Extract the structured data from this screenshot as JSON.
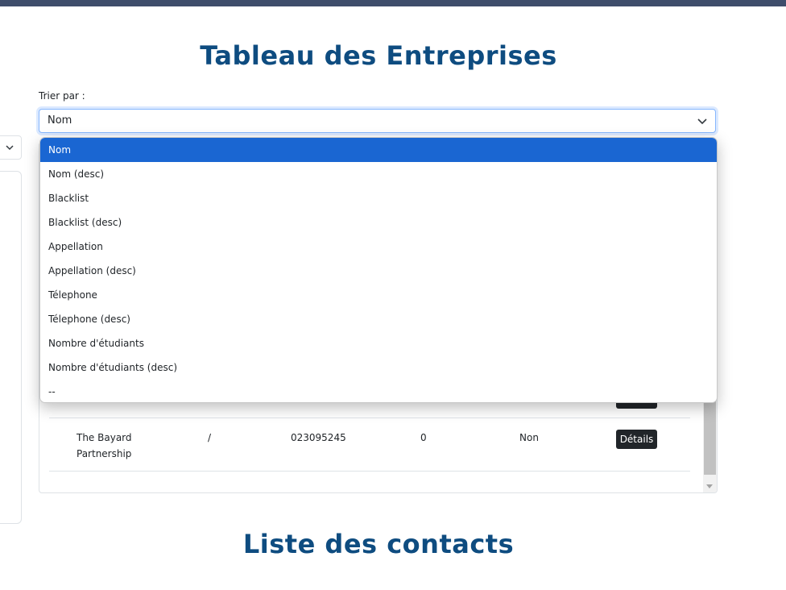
{
  "page": {
    "title": "Tableau des Entreprises",
    "contacts_title": "Liste des contacts"
  },
  "sort": {
    "label": "Trier par :",
    "selected": "Nom",
    "options": [
      "Nom",
      "Nom (desc)",
      "Blacklist",
      "Blacklist (desc)",
      "Appellation",
      "Appellation (desc)",
      "Télephone",
      "Télephone (desc)",
      "Nombre d'étudiants",
      "Nombre d'étudiants (desc)",
      "--"
    ]
  },
  "table": {
    "rows": [
      {
        "name_line1": "The Bayard",
        "name_line2": "Partnership",
        "appellation": "/",
        "phone": "023095245",
        "students": "0",
        "blacklist": "Non",
        "action": "Détails"
      }
    ]
  },
  "colors": {
    "topbar": "#3f4d6b",
    "heading": "#0e4c80",
    "selected_option": "#1a66d2",
    "button": "#212529"
  },
  "icons": {
    "select_chevron": "chevron-down-icon"
  }
}
